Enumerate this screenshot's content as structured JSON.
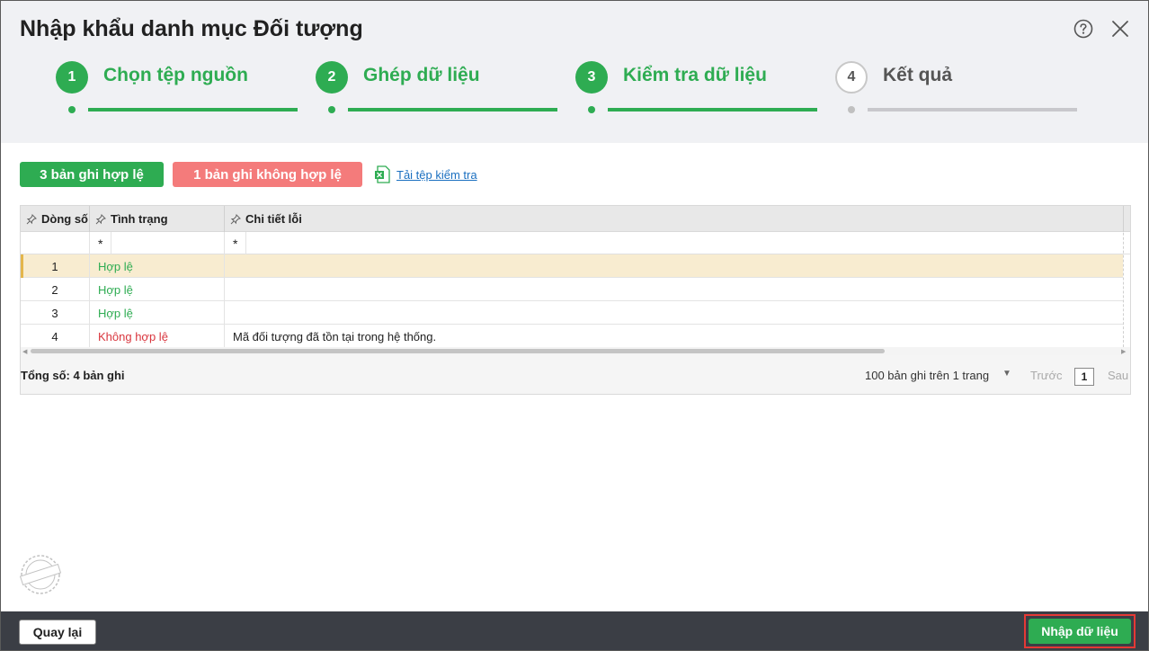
{
  "dialog": {
    "title": "Nhập khẩu danh mục Đối tượng",
    "help_icon": "question-circle-icon",
    "close_icon": "close-icon"
  },
  "steps": [
    {
      "number": "1",
      "label": "Chọn tệp nguồn",
      "state": "done"
    },
    {
      "number": "2",
      "label": "Ghép dữ liệu",
      "state": "done"
    },
    {
      "number": "3",
      "label": "Kiểm tra dữ liệu",
      "state": "active"
    },
    {
      "number": "4",
      "label": "Kết quả",
      "state": "pending"
    }
  ],
  "summary": {
    "valid_label": "3 bản ghi hợp lệ",
    "invalid_label": "1 bản ghi không hợp lệ",
    "download_label": "Tải tệp kiểm tra"
  },
  "grid": {
    "columns": [
      "Dòng số",
      "Tình trạng",
      "Chi tiết lỗi"
    ],
    "filter_placeholder": "*",
    "rows": [
      {
        "line": "1",
        "status": "Hợp lệ",
        "detail": "",
        "valid": true
      },
      {
        "line": "2",
        "status": "Hợp lệ",
        "detail": "",
        "valid": true
      },
      {
        "line": "3",
        "status": "Hợp lệ",
        "detail": "",
        "valid": true
      },
      {
        "line": "4",
        "status": "Không hợp lệ",
        "detail": "Mã đối tượng đã tồn tại trong hệ thống.",
        "valid": false
      }
    ],
    "total_label": "Tổng số: 4 bản ghi",
    "page_size_label": "100 bản ghi trên 1 trang",
    "prev_label": "Trước",
    "current_page": "1",
    "next_label": "Sau"
  },
  "footer": {
    "back_label": "Quay lại",
    "import_label": "Nhập dữ liệu"
  },
  "colors": {
    "accent": "#2eac52",
    "invalid_badge": "#f47b7b",
    "error_text": "#d9363e",
    "footer_bg": "#3b3e45",
    "highlight_border": "#e53935"
  }
}
